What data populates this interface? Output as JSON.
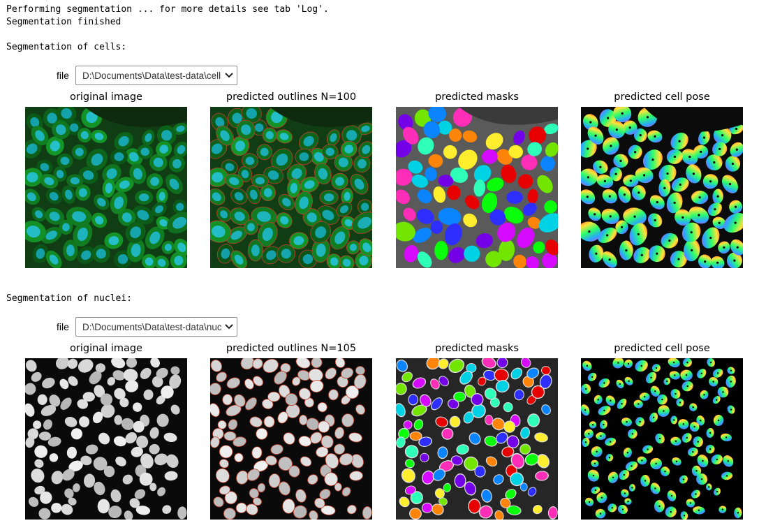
{
  "log": {
    "line1": "Performing segmentation ... for more details see tab 'Log'.",
    "line2": "Segmentation finished"
  },
  "sections": [
    {
      "heading": "Segmentation of cells:",
      "file_label": "file",
      "file_value": "D:\\Documents\\Data\\test-data\\cells.tif",
      "panels": [
        "original image",
        "predicted outlines N=100",
        "predicted masks",
        "predicted cell pose"
      ]
    },
    {
      "heading": "Segmentation of nuclei:",
      "file_label": "file",
      "file_value": "D:\\Documents\\Data\\test-data\\nuclei.tif",
      "panels": [
        "original image",
        "predicted outlines N=105",
        "predicted masks",
        "predicted cell pose"
      ]
    }
  ],
  "icons": {
    "dropdown": "chevron-down-icon"
  },
  "colors": {
    "cell_green": "#1e9a2a",
    "nucleus_blue": "#2f7fd6",
    "outline": "#c0402a"
  }
}
